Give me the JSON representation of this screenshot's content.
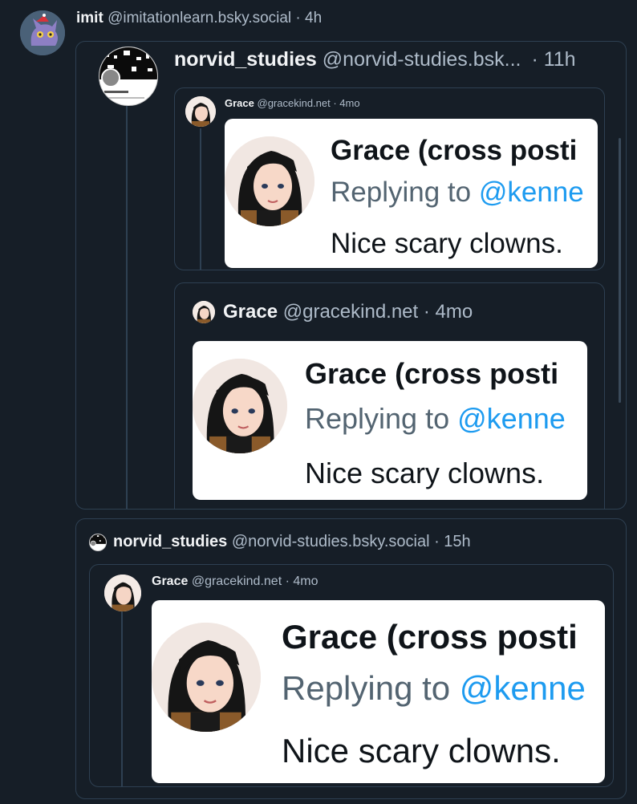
{
  "post": {
    "author": "imit",
    "handle": "@imitationlearn.bsky.social",
    "time": "· 4h"
  },
  "quote1": {
    "author": "norvid_studies",
    "handle": "@norvid-studies.bsk...",
    "time": "· 11h",
    "avatar_text": "norvid_studies",
    "nested_small": {
      "author": "Grace",
      "handle": "@gracekind.net · 4mo"
    },
    "nested_large": {
      "author": "Grace",
      "handle": "@gracekind.net",
      "time": "· 4mo"
    }
  },
  "quote2": {
    "author": "norvid_studies",
    "handle": "@norvid-studies.bsky.social",
    "time": "· 15h",
    "nested": {
      "author": "Grace",
      "handle": "@gracekind.net",
      "time": "· 4mo"
    }
  },
  "screenshot": {
    "title": "Grace (cross posti",
    "replying_prefix": "Replying to",
    "replying_handle": "@kenne",
    "body": "Nice scary clowns."
  },
  "colors": {
    "background": "#161e27",
    "border": "#2e4052",
    "handle": "#aebbc9",
    "link_blue": "#1d9bf0"
  }
}
